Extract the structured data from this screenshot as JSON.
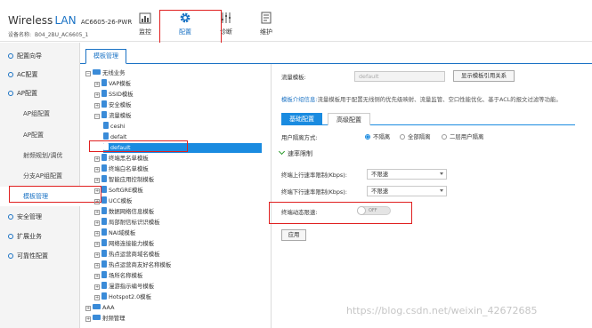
{
  "header": {
    "brand_word": "Wireless",
    "brand_accent": "LAN",
    "model": "AC6605-26-PWR",
    "device_label": "设备名称:",
    "device_name": "B04_2BU_AC6605_1",
    "nav": [
      {
        "label": "监控",
        "icon": "monitor-icon"
      },
      {
        "label": "配置",
        "icon": "gear-icon",
        "active": true
      },
      {
        "label": "诊断",
        "icon": "diagnosis-icon"
      },
      {
        "label": "维护",
        "icon": "maintenance-icon"
      }
    ]
  },
  "sidebar": {
    "items": [
      {
        "label": "配置向导"
      },
      {
        "label": "AC配置"
      },
      {
        "label": "AP配置"
      },
      {
        "label": "AP组配置"
      },
      {
        "label": "AP配置"
      },
      {
        "label": "射频规划/调优"
      },
      {
        "label": "分支AP组配置"
      },
      {
        "label": "模板管理"
      },
      {
        "label": "安全管理"
      },
      {
        "label": "扩展业务"
      },
      {
        "label": "可靠性配置"
      }
    ]
  },
  "main": {
    "tab": "模板管理",
    "tree": [
      "无线业务",
      "VAP模板",
      "SSID模板",
      "安全模板",
      "流量模板",
      "ceshi",
      "defalt",
      "default",
      "终端黑名单模板",
      "终端白名单模板",
      "智能应用控制模板",
      "SoftGRE模板",
      "UCC模板",
      "数据网络信息模板",
      "局部耐信标识识模板",
      "NAI域模板",
      "网络连接能力模板",
      "热点运营商域名模板",
      "热点运营商友好名称模板",
      "场所名称模板",
      "漫游指示编号模板",
      "Hotspot2.0模板",
      "AAA",
      "射频管理"
    ]
  },
  "panel": {
    "template_label": "流量模板:",
    "template_value": "default",
    "show_ref_button": "显示模板引用关系",
    "desc_link": "模板介绍信息:",
    "desc_text": "流量模板用于配置无线侧的优先级映射、流量监管、空口性能优化、基于ACL的报文过滤等功能。",
    "tab_basic": "基础配置",
    "tab_advanced": "高级配置",
    "isolation_label": "用户隔离方式:",
    "isolation_options": [
      "不隔离",
      "全部隔离",
      "二层用户隔离"
    ],
    "isolation_selected": 0,
    "section_title": "速率限制",
    "uplink_label": "终端上行速率限制(Kbps):",
    "uplink_value": "不限速",
    "downlink_label": "终端下行速率限制(Kbps):",
    "downlink_value": "不限速",
    "dynamic_label": "终端动态限速:",
    "dynamic_state": "OFF",
    "apply_button": "应用"
  },
  "watermark": "https://blog.csdn.net/weixin_42672685"
}
